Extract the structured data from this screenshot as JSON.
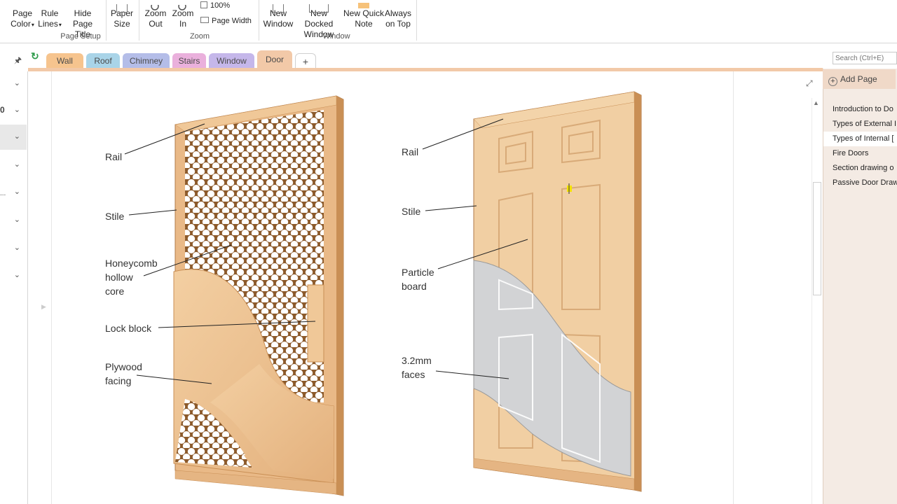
{
  "ribbon": {
    "page_setup": {
      "group_label": "Page Setup",
      "page_color": [
        "Page",
        "Color"
      ],
      "rule_lines": [
        "Rule",
        "Lines"
      ],
      "hide_title": [
        "Hide",
        "Page Title"
      ],
      "paper_size": [
        "Paper",
        "Size"
      ]
    },
    "zoom": {
      "group_label": "Zoom",
      "zoom_out": [
        "Zoom",
        "Out"
      ],
      "zoom_in": [
        "Zoom",
        "In"
      ],
      "percent": "100%",
      "page_width": "Page Width"
    },
    "window": {
      "group_label": "Window",
      "new_window": [
        "New",
        "Window"
      ],
      "new_docked": [
        "New Docked",
        "Window"
      ],
      "new_quick_note": [
        "New Quick",
        "Note"
      ],
      "always_on_top": [
        "Always",
        "on Top"
      ]
    }
  },
  "section_tabs": [
    {
      "label": "Wall",
      "color": "#f6c48e"
    },
    {
      "label": "Roof",
      "color": "#a9d4e8"
    },
    {
      "label": "Chimney",
      "color": "#b4bde8"
    },
    {
      "label": "Stairs",
      "color": "#eab0dc"
    },
    {
      "label": "Window",
      "color": "#c5b7ea"
    },
    {
      "label": "Door",
      "color": "#f2c9a8"
    }
  ],
  "add_tab_label": "+",
  "search": {
    "placeholder": "Search (Ctrl+E)"
  },
  "left_pane": {
    "partial_text_1": "0",
    "partial_text_2": "..."
  },
  "pages_pane": {
    "add_page": "Add Page",
    "pages": [
      {
        "label": "Introduction to Do",
        "selected": false
      },
      {
        "label": "Types of External I",
        "selected": false
      },
      {
        "label": "Types of Internal [",
        "selected": true
      },
      {
        "label": "Fire Doors",
        "selected": false
      },
      {
        "label": "Section drawing o",
        "selected": false
      },
      {
        "label": "Passive Door Draw",
        "selected": false
      }
    ]
  },
  "diagram": {
    "left_door": {
      "rail": "Rail",
      "stile": "Stile",
      "honeycomb": [
        "Honeycomb",
        "hollow",
        "core"
      ],
      "lock_block": "Lock block",
      "plywood": [
        "Plywood",
        "facing"
      ]
    },
    "right_door": {
      "rail": "Rail",
      "stile": "Stile",
      "particle": [
        "Particle",
        "board"
      ],
      "faces": [
        "3.2mm",
        "faces"
      ]
    }
  },
  "colors": {
    "wood_light": "#f1cfa3",
    "wood_mid": "#e5b583",
    "wood_dark": "#c98f55",
    "face_grey": "#d2d3d5",
    "accent_orange": "#f2c9a8"
  }
}
